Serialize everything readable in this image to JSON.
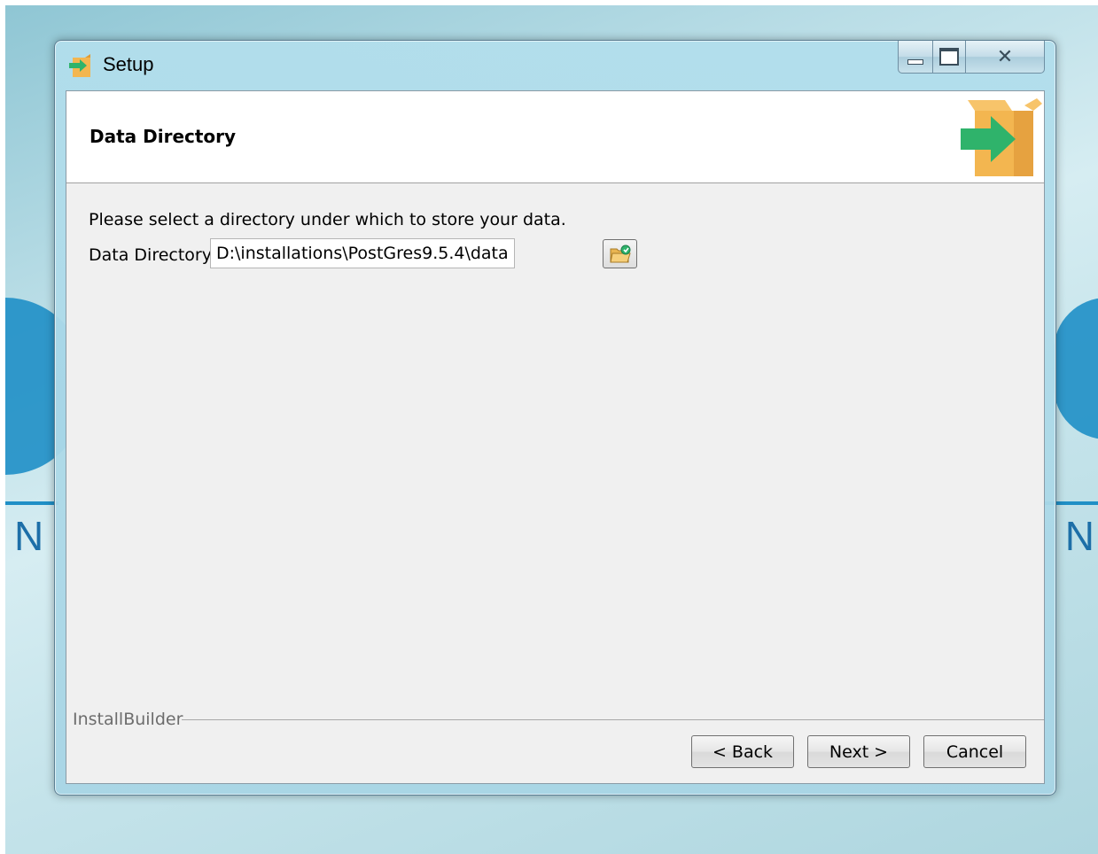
{
  "window": {
    "title": "Setup"
  },
  "header": {
    "title": "Data Directory"
  },
  "content": {
    "instruction": "Please select a directory under which to store your data.",
    "field_label": "Data Directory",
    "field_value": "D:\\installations\\PostGres9.5.4\\data"
  },
  "footer": {
    "brand": "InstallBuilder",
    "back_label": "< Back",
    "next_label": "Next >",
    "cancel_label": "Cancel"
  },
  "desktop": {
    "letter_left": "N",
    "letter_right": "N"
  },
  "colors": {
    "accent_green": "#2fb36b",
    "box_orange": "#f3b650",
    "titlebar": "#b2deec"
  },
  "icons": {
    "app": "setup-box-arrow-icon",
    "header": "setup-box-arrow-icon",
    "browse": "folder-browse-icon"
  }
}
